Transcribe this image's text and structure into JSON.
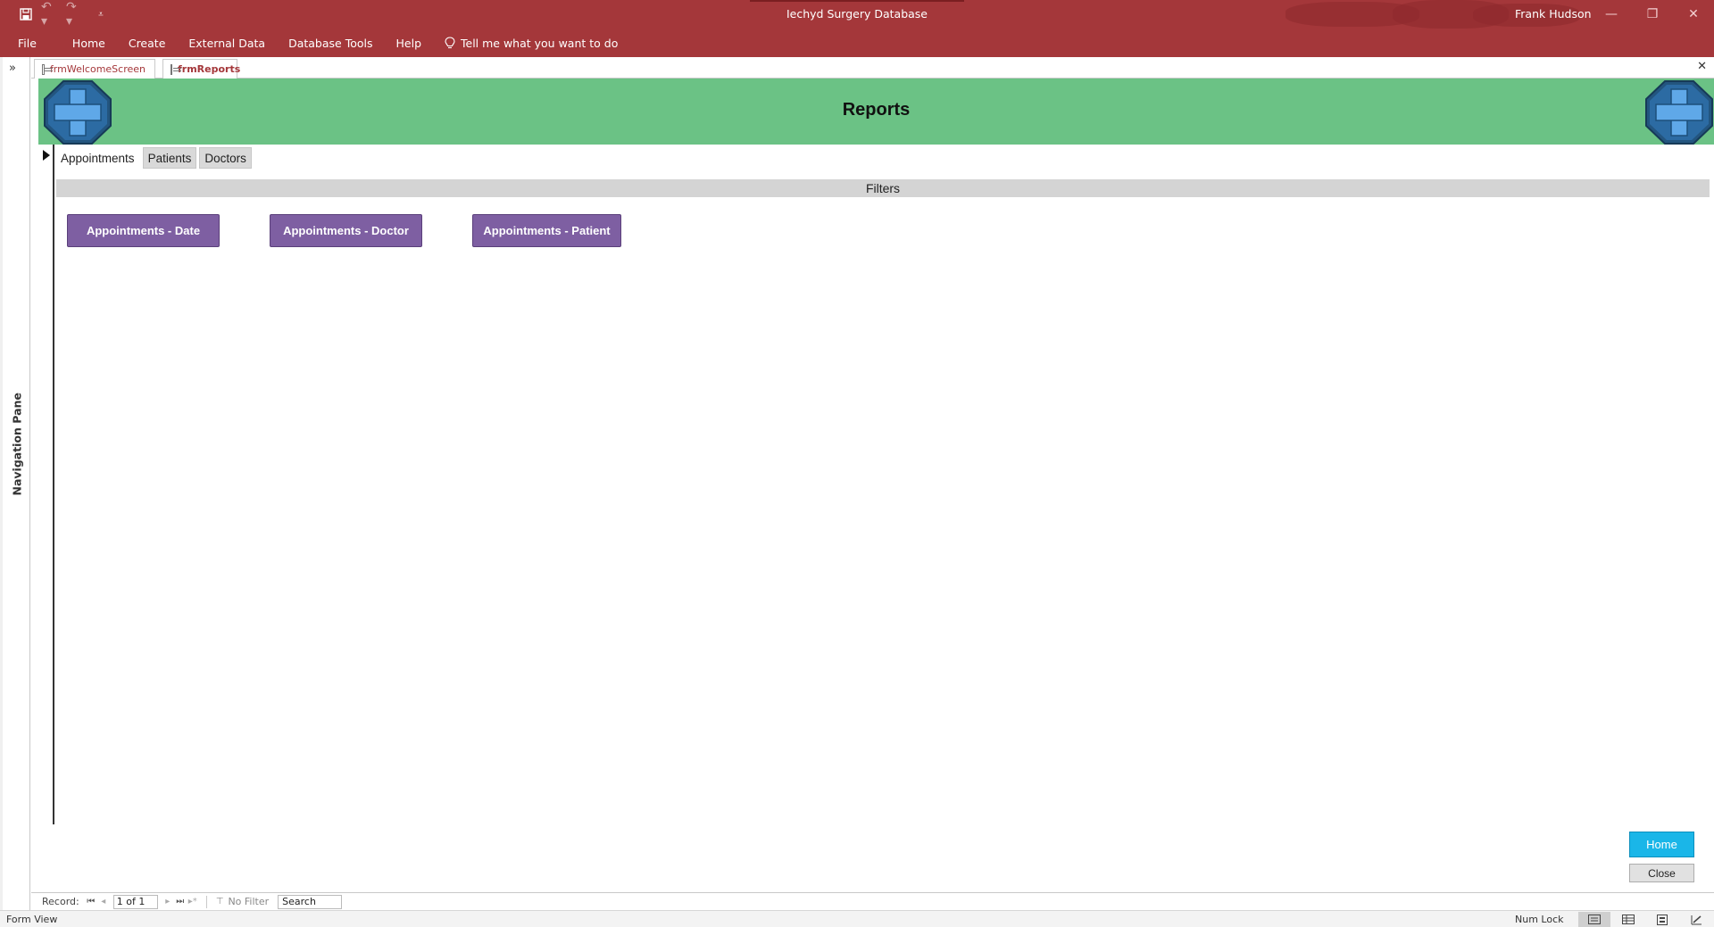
{
  "titlebar": {
    "title": "Iechyd Surgery Database",
    "user": "Frank Hudson",
    "qat_icons": [
      "save-icon",
      "undo-icon",
      "redo-icon",
      "customize-icon"
    ],
    "window_controls": [
      "minimize-icon",
      "restore-icon",
      "close-icon"
    ]
  },
  "ribbon": {
    "tabs": [
      "File",
      "Home",
      "Create",
      "External Data",
      "Database Tools",
      "Help"
    ],
    "tellme": "Tell me what you want to do"
  },
  "navpane": {
    "label": "Navigation Pane",
    "toggle": "»"
  },
  "doctabs": [
    {
      "label": "frmWelcomeScreen",
      "active": false
    },
    {
      "label": "frmReports",
      "active": true
    }
  ],
  "form": {
    "title": "Reports",
    "header_color": "#6bc285",
    "subtabs": [
      "Appointments",
      "Patients",
      "Doctors"
    ],
    "active_subtab": "Appointments",
    "filters_label": "Filters",
    "report_buttons": [
      "Appointments - Date",
      "Appointments - Doctor",
      "Appointments - Patient"
    ],
    "report_button_color": "#7e5fa2",
    "home_label": "Home",
    "home_color": "#1ab6e8",
    "close_label": "Close"
  },
  "record_nav": {
    "label": "Record:",
    "position": "1 of 1",
    "filter_status": "No Filter",
    "search_placeholder": "Search"
  },
  "statusbar": {
    "view": "Form View",
    "num_lock": "Num Lock"
  },
  "accent_color": "#a4373a"
}
